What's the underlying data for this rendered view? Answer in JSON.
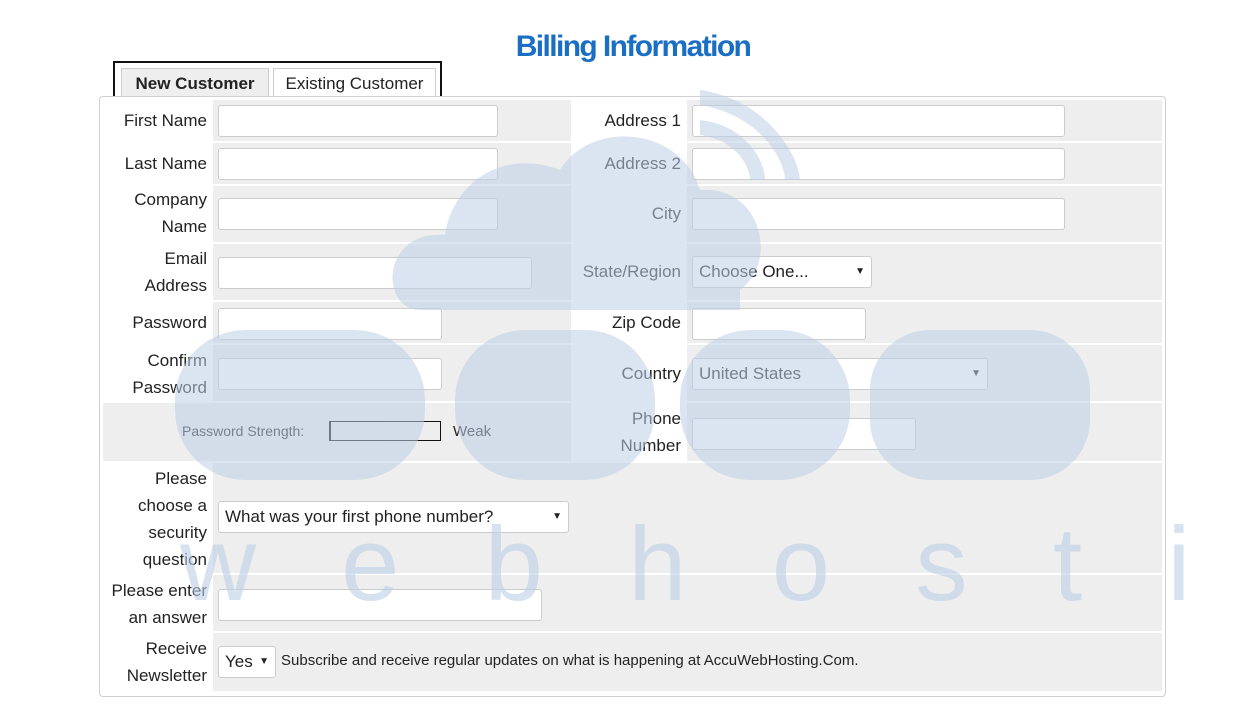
{
  "title": "Billing Information",
  "colors": {
    "title": "#1a6fc4",
    "watermark": "#c7d7e8"
  },
  "tabs": [
    {
      "label": "New Customer",
      "active": true
    },
    {
      "label": "Existing Customer",
      "active": false
    }
  ],
  "left": {
    "first_name": {
      "label": "First Name",
      "value": ""
    },
    "last_name": {
      "label": "Last Name",
      "value": ""
    },
    "company_name": {
      "label_1": "Company",
      "label_2": "Name",
      "value": ""
    },
    "email": {
      "label_1": "Email",
      "label_2": "Address",
      "value": ""
    },
    "password": {
      "label": "Password",
      "value": ""
    },
    "confirm_password": {
      "label_1": "Confirm",
      "label_2": "Password",
      "value": ""
    },
    "password_strength": {
      "label": "Password Strength:",
      "value": "Weak",
      "level": 0
    }
  },
  "right": {
    "address1": {
      "label": "Address 1",
      "value": ""
    },
    "address2": {
      "label": "Address 2",
      "value": ""
    },
    "city": {
      "label": "City",
      "value": ""
    },
    "state": {
      "label": "State/Region",
      "selected": "Choose One..."
    },
    "zip": {
      "label": "Zip Code",
      "value": ""
    },
    "country": {
      "label": "Country",
      "selected": "United States"
    },
    "phone": {
      "label_1": "Phone",
      "label_2": "Number",
      "value": ""
    }
  },
  "security": {
    "question_label": [
      "Please",
      "choose a",
      "security",
      "question"
    ],
    "question_selected": "What was your first phone number?",
    "answer_label_1": "Please enter",
    "answer_label_2": "an answer",
    "answer_value": ""
  },
  "newsletter": {
    "label_1": "Receive",
    "label_2": "Newsletter",
    "selected": "Yes",
    "description": "Subscribe and receive regular updates on what is happening at AccuWebHosting.Com."
  },
  "icons": {
    "dropdown": "▼"
  },
  "watermark": {
    "text": "w e b   h o s t i n g"
  }
}
